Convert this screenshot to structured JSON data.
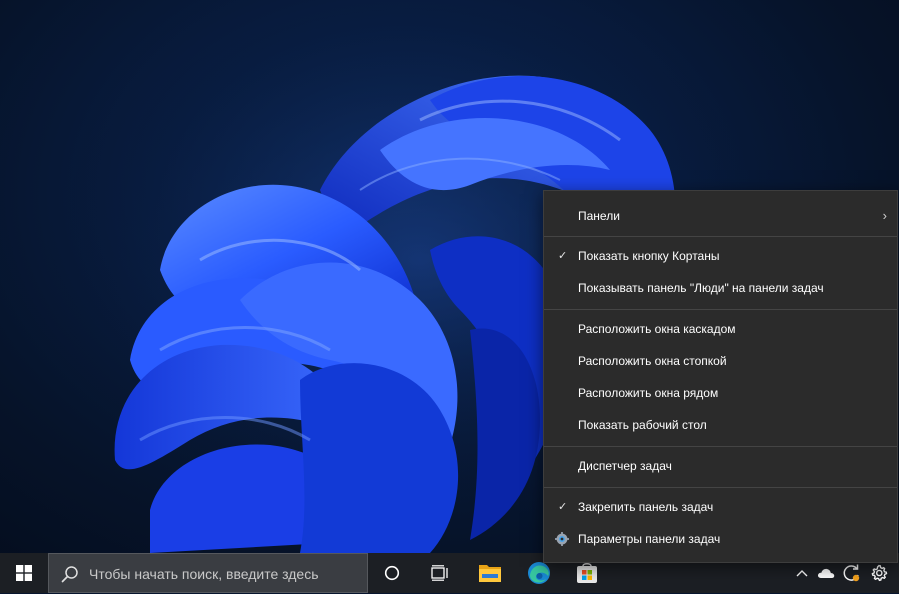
{
  "context_menu": {
    "panels_label": "Панели",
    "show_cortana_label": "Показать кнопку Кортаны",
    "show_people_label": "Показывать панель \"Люди\" на панели задач",
    "cascade_label": "Расположить окна каскадом",
    "stack_label": "Расположить окна стопкой",
    "side_by_side_label": "Расположить окна рядом",
    "show_desktop_label": "Показать рабочий стол",
    "task_manager_label": "Диспетчер задач",
    "lock_taskbar_label": "Закрепить панель задач",
    "taskbar_settings_label": "Параметры панели задач",
    "checked_items": [
      "show_cortana",
      "lock_taskbar"
    ]
  },
  "taskbar": {
    "search_placeholder": "Чтобы начать поиск, введите здесь",
    "pinned_apps": [
      "cortana",
      "task-view",
      "file-explorer",
      "edge",
      "store"
    ],
    "tray_icons": [
      "chevron-up",
      "onedrive",
      "update-sync",
      "settings"
    ]
  },
  "colors": {
    "menu_bg": "#2b2b2b",
    "taskbar_bg": "#1c1f24",
    "search_bg": "#3a3d42",
    "accent_blue": "#1e4fff"
  }
}
